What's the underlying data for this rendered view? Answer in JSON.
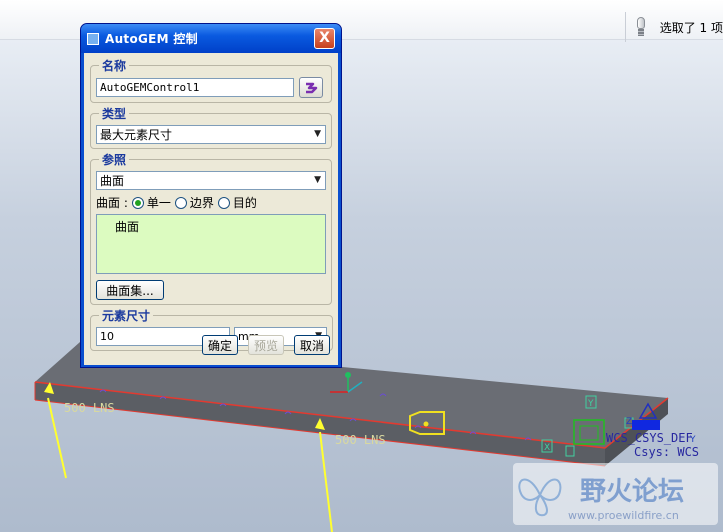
{
  "status": {
    "selection_text": "选取了 1 项"
  },
  "dialog": {
    "title": "AutoGEM 控制",
    "close_label": "X",
    "name": {
      "legend": "名称",
      "value": "AutoGEMControl1"
    },
    "type": {
      "legend": "类型",
      "selected": "最大元素尺寸"
    },
    "reference": {
      "legend": "参照",
      "selected": "曲面",
      "radio_label": "曲面 :",
      "options": [
        "单一",
        "边界",
        "目的"
      ],
      "selected_option": "单一",
      "list_items": [
        "曲面"
      ],
      "surface_set_button": "曲面集..."
    },
    "element_size": {
      "legend": "元素尺寸",
      "value": "10",
      "unit": "mm"
    },
    "buttons": {
      "ok": "确定",
      "preview": "预览",
      "cancel": "取消"
    }
  },
  "viewport": {
    "labels": {
      "wcs_def": "WCS_CSYS_DEF",
      "csys": "Csys: WCS",
      "load_a": "500 LNS",
      "load_b": "500 LNS",
      "axis_y": "Y",
      "axis_x": "X",
      "axis_z": "Z",
      "axis_y2": "Y"
    },
    "colors": {
      "plate": "#686b72",
      "edge": "#e0302c",
      "load": "#ffff30",
      "constraint": "#20c020"
    }
  },
  "watermark": {
    "brand": "野火论坛",
    "url": "www.proewildfire.cn"
  }
}
